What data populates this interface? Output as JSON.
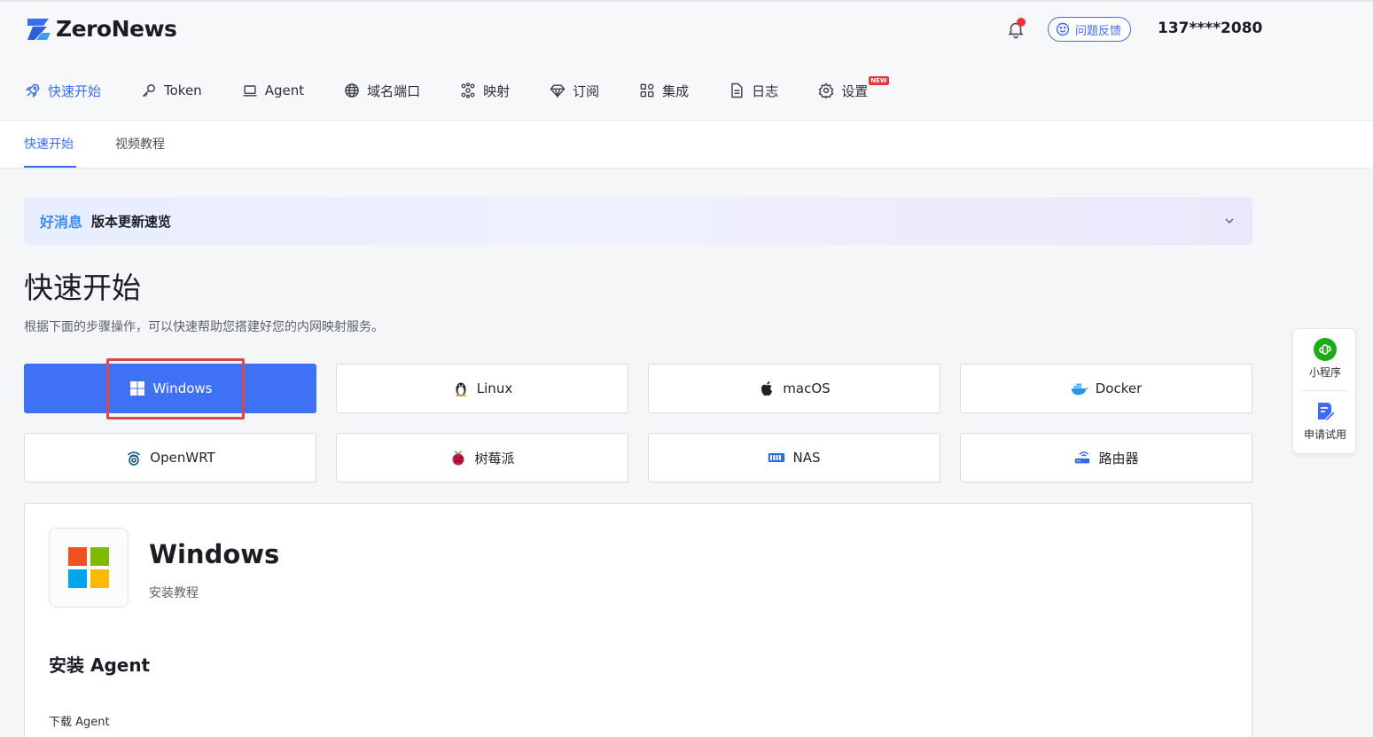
{
  "app": {
    "name": "ZeroNews",
    "user": "137****2080",
    "feedback_label": "问题反馈"
  },
  "nav": [
    {
      "label": "快速开始",
      "icon": "rocket-icon",
      "active": true
    },
    {
      "label": "Token",
      "icon": "key-icon"
    },
    {
      "label": "Agent",
      "icon": "laptop-icon"
    },
    {
      "label": "域名端口",
      "icon": "globe-icon"
    },
    {
      "label": "映射",
      "icon": "network-icon"
    },
    {
      "label": "订阅",
      "icon": "diamond-icon"
    },
    {
      "label": "集成",
      "icon": "apps-icon"
    },
    {
      "label": "日志",
      "icon": "file-icon"
    },
    {
      "label": "设置",
      "icon": "gear-icon",
      "badge": "NEW"
    }
  ],
  "subtabs": [
    {
      "label": "快速开始",
      "active": true
    },
    {
      "label": "视频教程"
    }
  ],
  "banner": {
    "tag": "好消息",
    "title": "版本更新速览"
  },
  "main": {
    "title": "快速开始",
    "description": "根据下面的步骤操作，可以快速帮助您搭建好您的内网映射服务。"
  },
  "platforms": [
    {
      "label": "Windows",
      "icon": "windows-icon",
      "active": true
    },
    {
      "label": "Linux",
      "icon": "linux-icon"
    },
    {
      "label": "macOS",
      "icon": "apple-icon"
    },
    {
      "label": "Docker",
      "icon": "docker-icon"
    },
    {
      "label": "OpenWRT",
      "icon": "openwrt-icon"
    },
    {
      "label": "树莓派",
      "icon": "raspberry-icon"
    },
    {
      "label": "NAS",
      "icon": "nas-icon"
    },
    {
      "label": "路由器",
      "icon": "router-icon"
    }
  ],
  "card": {
    "title": "Windows",
    "subtitle": "安装教程",
    "section_title": "安装 Agent",
    "step_label": "下载 Agent"
  },
  "side_panel": [
    {
      "label": "小程序",
      "icon": "mini-program-icon"
    },
    {
      "label": "申请试用",
      "icon": "apply-trial-icon"
    }
  ],
  "colors": {
    "primary": "#3f71f5",
    "accent_red": "#f0313a",
    "banner_tag": "#3c8cf0"
  }
}
